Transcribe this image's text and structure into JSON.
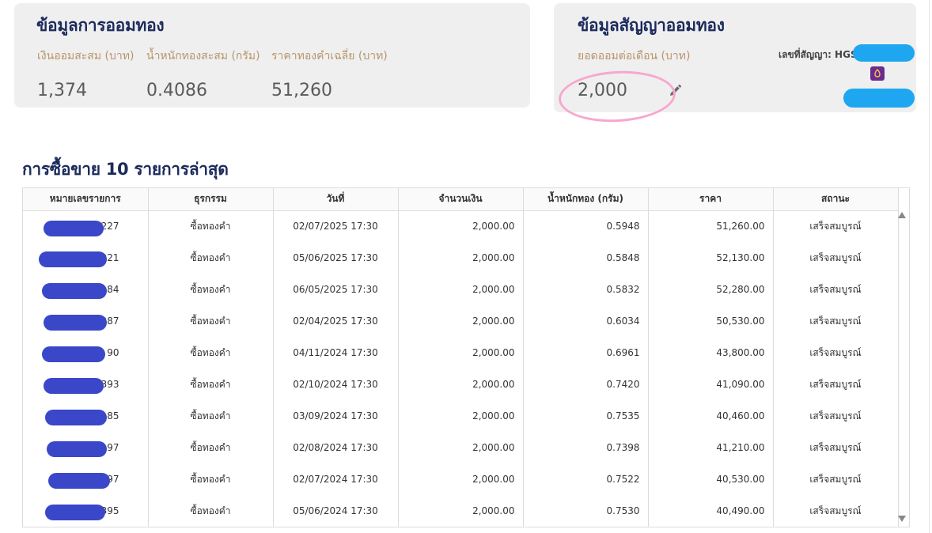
{
  "savings": {
    "title": "ข้อมูลการออมทอง",
    "stats": [
      {
        "label": "เงินออมสะสม (บาท)",
        "value": "1,374"
      },
      {
        "label": "น้ำหนักทองสะสม (กรัม)",
        "value": "0.4086"
      },
      {
        "label": "ราคาทองคำเฉลี่ย (บาท)",
        "value": "51,260"
      }
    ]
  },
  "contract": {
    "title": "ข้อมูลสัญญาออมทอง",
    "monthly_label": "ยอดออมต่อเดือน (บาท)",
    "monthly_value": "2,000",
    "contract_no_label": "เลขที่สัญญา: HGS",
    "edit_icon": "pencil-icon",
    "highlight_color": "#f7a8cf",
    "redaction_color": "#1ea7f0"
  },
  "transactions": {
    "title": "การซื้อขาย 10 รายการล่าสุด",
    "columns": [
      "หมายเลขรายการ",
      "ธุรกรรม",
      "วันที่",
      "จำนวนเงิน",
      "น้ำหนักทอง (กรัม)",
      "ราคา",
      "สถานะ"
    ],
    "rows": [
      {
        "id": "227",
        "type": "ซื้อทองคำ",
        "date": "02/07/2025  17:30",
        "amount": "2,000.00",
        "weight": "0.5948",
        "price": "51,260.00",
        "status": "เสร็จสมบูรณ์"
      },
      {
        "id": "221",
        "type": "ซื้อทองคำ",
        "date": "05/06/2025  17:30",
        "amount": "2,000.00",
        "weight": "0.5848",
        "price": "52,130.00",
        "status": "เสร็จสมบูรณ์"
      },
      {
        "id": "84",
        "type": "ซื้อทองคำ",
        "date": "06/05/2025  17:30",
        "amount": "2,000.00",
        "weight": "0.5832",
        "price": "52,280.00",
        "status": "เสร็จสมบูรณ์"
      },
      {
        "id": "287",
        "type": "ซื้อทองคำ",
        "date": "02/04/2025  17:30",
        "amount": "2,000.00",
        "weight": "0.6034",
        "price": "50,530.00",
        "status": "เสร็จสมบูรณ์"
      },
      {
        "id": "90",
        "type": "ซื้อทองคำ",
        "date": "04/11/2024  17:30",
        "amount": "2,000.00",
        "weight": "0.6961",
        "price": "43,800.00",
        "status": "เสร็จสมบูรณ์"
      },
      {
        "id": "393",
        "type": "ซื้อทองคำ",
        "date": "02/10/2024  17:30",
        "amount": "2,000.00",
        "weight": "0.7420",
        "price": "41,090.00",
        "status": "เสร็จสมบูรณ์"
      },
      {
        "id": "85",
        "type": "ซื้อทองคำ",
        "date": "03/09/2024  17:30",
        "amount": "2,000.00",
        "weight": "0.7535",
        "price": "40,460.00",
        "status": "เสร็จสมบูรณ์"
      },
      {
        "id": "97",
        "type": "ซื้อทองคำ",
        "date": "02/08/2024  17:30",
        "amount": "2,000.00",
        "weight": "0.7398",
        "price": "41,210.00",
        "status": "เสร็จสมบูรณ์"
      },
      {
        "id": "97",
        "type": "ซื้อทองคำ",
        "date": "02/07/2024  17:30",
        "amount": "2,000.00",
        "weight": "0.7522",
        "price": "40,530.00",
        "status": "เสร็จสมบูรณ์"
      },
      {
        "id": "395",
        "type": "ซื้อทองคำ",
        "date": "05/06/2024  17:30",
        "amount": "2,000.00",
        "weight": "0.7530",
        "price": "40,490.00",
        "status": "เสร็จสมบูรณ์"
      }
    ],
    "redaction_color": "#3a47c9"
  },
  "colors": {
    "title": "#1b2a5c",
    "label": "#b8956a",
    "card_bg": "#efefef"
  }
}
